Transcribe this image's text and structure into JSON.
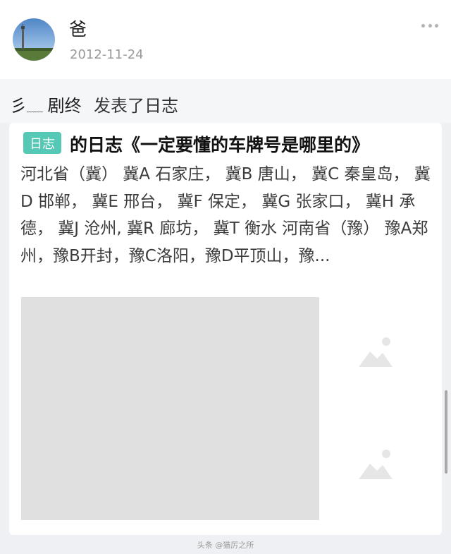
{
  "post": {
    "author_name": "爸",
    "date": "2012-11-24",
    "share_user": "彡",
    "share_user_wave": "﹏﹏",
    "share_user_suffix": "剧终",
    "share_action": "发表了日志"
  },
  "blog": {
    "tag": "日志",
    "title": "的日志《一定要懂的车牌号是哪里的》",
    "excerpt": "河北省（冀） 冀A 石家庄， 冀B 唐山， 冀C 秦皇岛， 冀D 邯郸， 冀E 邢台， 冀F 保定， 冀G 张家口， 冀H 承德， 冀J 沧州, 冀R 廊坊， 冀T 衡水 河南省（豫） 豫A郑州，豫B开封，豫C洛阳，豫D平顶山，豫..."
  },
  "watermark": "头条 @猫厉之所",
  "icons": {
    "more": "more-dots-icon",
    "image": "image-placeholder-icon"
  },
  "colors": {
    "tag_bg": "#55c8b6",
    "card_bg": "#ffffff",
    "page_bg": "#eef0f3",
    "placeholder_bg": "#e0e0e0"
  }
}
